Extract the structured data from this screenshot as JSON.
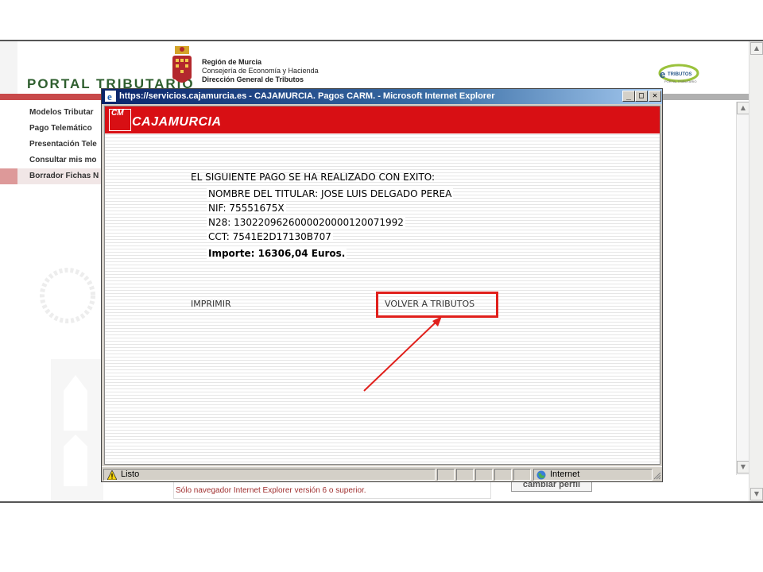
{
  "portal": {
    "title_prefix": "PORTAL ",
    "title_main": "TRIBUTARIO",
    "region_lines": [
      "Región de Murcia",
      "Consejería de Economía y Hacienda",
      "Dirección General de Tributos"
    ],
    "side_menu": [
      "Modelos Tributar",
      "Pago Telemático",
      "Presentación Tele",
      "Consultar mis mo",
      "Borrador Fichas N"
    ],
    "footer_note": "Sólo navegador Internet Explorer versión 6 o superior.",
    "cambiar_button": "cambiar perfil"
  },
  "popup": {
    "window_title": "https://servicios.cajamurcia.es - CAJAMURCIA. Pagos CARM. - Microsoft Internet Explorer",
    "minimize": "_",
    "maximize": "□",
    "close": "✕",
    "brand_small": "CM",
    "brand_name": "CAJAMURCIA",
    "success_title": "EL SIGUIENTE PAGO SE HA REALIZADO CON EXITO:",
    "details": {
      "titular": "NOMBRE DEL TITULAR: JOSE LUIS DELGADO PEREA",
      "nif": "NIF: 75551675X",
      "n28": "N28: 1302209626000020000120071992",
      "cct": "CCT: 7541E2D17130B707",
      "importe": "Importe: 16306,04 Euros."
    },
    "print_link": "IMPRIMIR",
    "back_link": "VOLVER A TRIBUTOS",
    "status_text": "Listo",
    "zone_text": "Internet",
    "highlight_color": "#e0201c"
  },
  "icons": [
    "ie-icon",
    "warning-icon",
    "globe-icon",
    "resize-grip-icon",
    "scroll-up-icon",
    "scroll-down-icon"
  ]
}
